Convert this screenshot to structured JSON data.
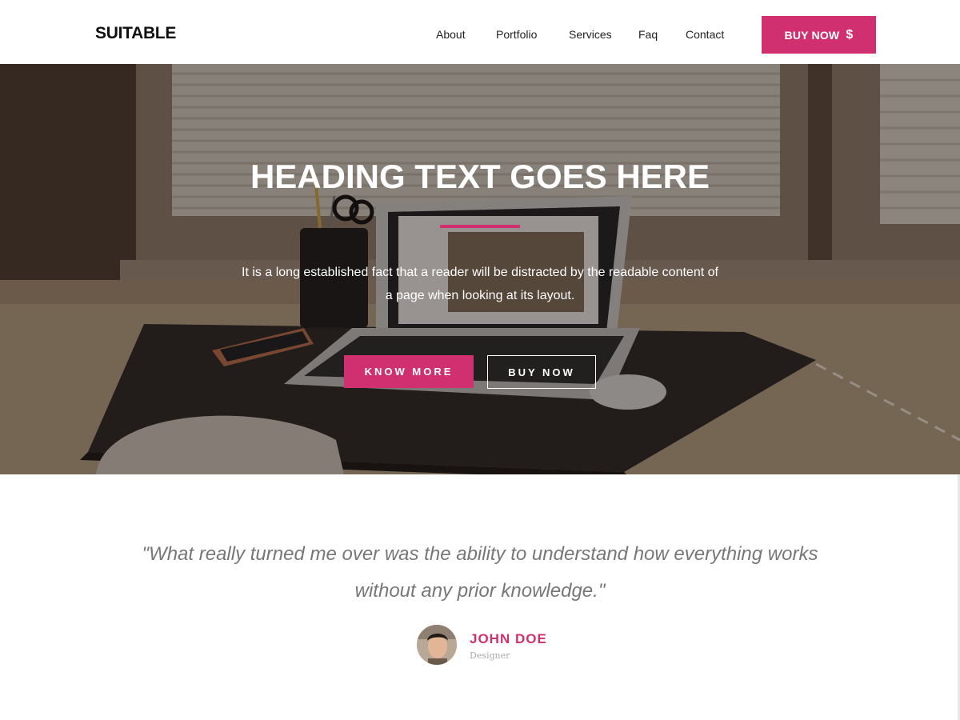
{
  "header": {
    "brand": "SUITABLE",
    "nav": [
      {
        "label": "About"
      },
      {
        "label": "Portfolio"
      },
      {
        "label": "Services"
      },
      {
        "label": "Faq"
      },
      {
        "label": "Contact"
      }
    ],
    "buy_button": {
      "label": "BUY NOW",
      "icon": "dollar-icon",
      "symbol": "$"
    }
  },
  "hero": {
    "title": "HEADING TEXT GOES HERE",
    "description": "It is a long established fact that a reader will be distracted by the readable content of a page when looking at its layout.",
    "primary_button": "KNOW MORE",
    "secondary_button": "BUY NOW",
    "background_image": "desk-laptop-photo"
  },
  "testimonial": {
    "quote": "\"What really turned me over was the ability to understand how everything works without any prior knowledge.\"",
    "author_name": "JOHN DOE",
    "author_role": "Designer"
  },
  "colors": {
    "accent": "#d0306f",
    "text_dark": "#222222",
    "quote_text": "#777777"
  }
}
